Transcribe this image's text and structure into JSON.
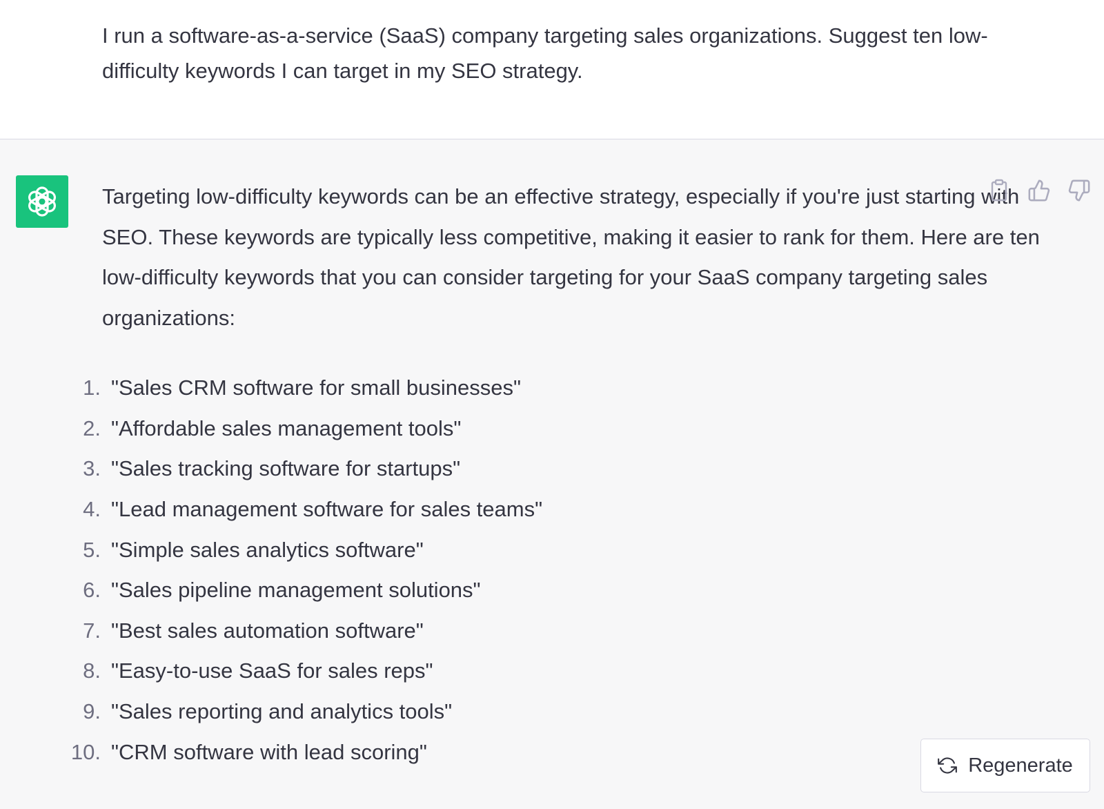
{
  "user_message": {
    "text": "I run a software-as-a-service (SaaS) company targeting sales organizations. Suggest ten low-difficulty keywords I can target in my SEO strategy."
  },
  "assistant_message": {
    "intro": "Targeting low-difficulty keywords can be an effective strategy, especially if you're just starting with SEO. These keywords are typically less competitive, making it easier to rank for them. Here are ten low-difficulty keywords that you can consider targeting for your SaaS company targeting sales organizations:",
    "keywords": [
      {
        "num": "1.",
        "text": "\"Sales CRM software for small businesses\""
      },
      {
        "num": "2.",
        "text": "\"Affordable sales management tools\""
      },
      {
        "num": "3.",
        "text": "\"Sales tracking software for startups\""
      },
      {
        "num": "4.",
        "text": "\"Lead management software for sales teams\""
      },
      {
        "num": "5.",
        "text": "\"Simple sales analytics software\""
      },
      {
        "num": "6.",
        "text": "\"Sales pipeline management solutions\""
      },
      {
        "num": "7.",
        "text": "\"Best sales automation software\""
      },
      {
        "num": "8.",
        "text": "\"Easy-to-use SaaS for sales reps\""
      },
      {
        "num": "9.",
        "text": "\"Sales reporting and analytics tools\""
      },
      {
        "num": "10.",
        "text": "\"CRM software with lead scoring\""
      }
    ],
    "actions": {
      "copy_icon": "clipboard-icon",
      "like_icon": "thumbs-up-icon",
      "dislike_icon": "thumbs-down-icon"
    },
    "avatar_color": "#19c37d"
  },
  "regenerate": {
    "label": "Regenerate",
    "icon": "refresh-icon"
  }
}
